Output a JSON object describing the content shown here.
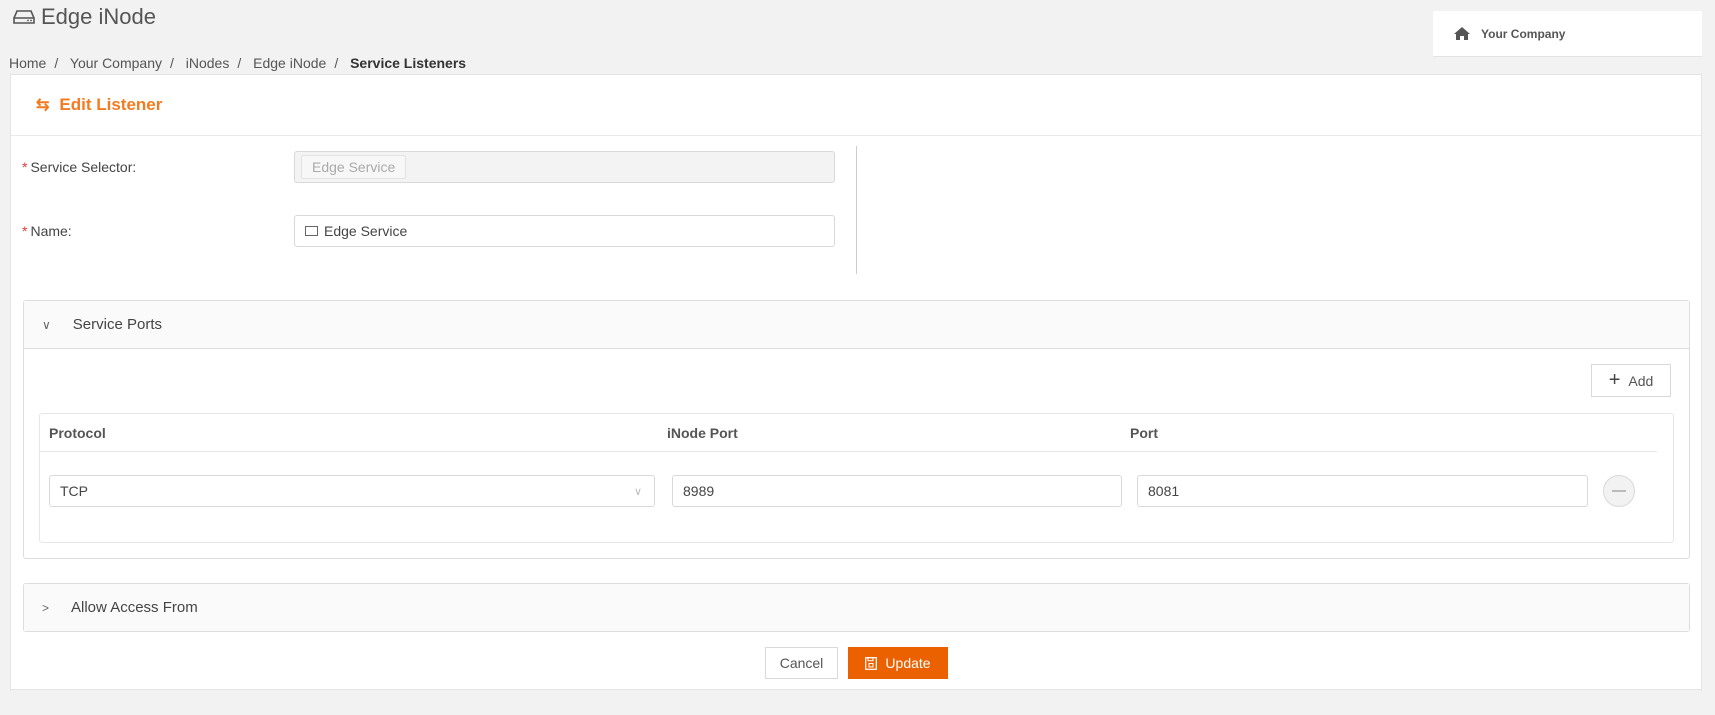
{
  "header": {
    "title": "Edge iNode",
    "icon": "hdd-icon"
  },
  "breadcrumb": [
    "Home",
    "Your Company",
    "iNodes",
    "Edge iNode"
  ],
  "breadcrumb_current": "Service Listeners",
  "company": {
    "name": "Your Company",
    "icon": "home-icon"
  },
  "card": {
    "title": "Edit Listener",
    "icon": "swap-icon",
    "accent": "#f47b20"
  },
  "form": {
    "service_selector": {
      "label": "Service Selector:",
      "value": "Edge Service"
    },
    "name": {
      "label": "Name:",
      "value": "Edge Service"
    }
  },
  "service_ports": {
    "title": "Service Ports",
    "add_label": "Add",
    "columns": [
      "Protocol",
      "iNode Port",
      "Port"
    ],
    "rows": [
      {
        "protocol": "TCP",
        "inode_port": "8989",
        "port": "8081"
      }
    ]
  },
  "allow_access": {
    "title": "Allow Access From"
  },
  "actions": {
    "cancel": "Cancel",
    "update": "Update",
    "update_color": "#eb6100"
  }
}
